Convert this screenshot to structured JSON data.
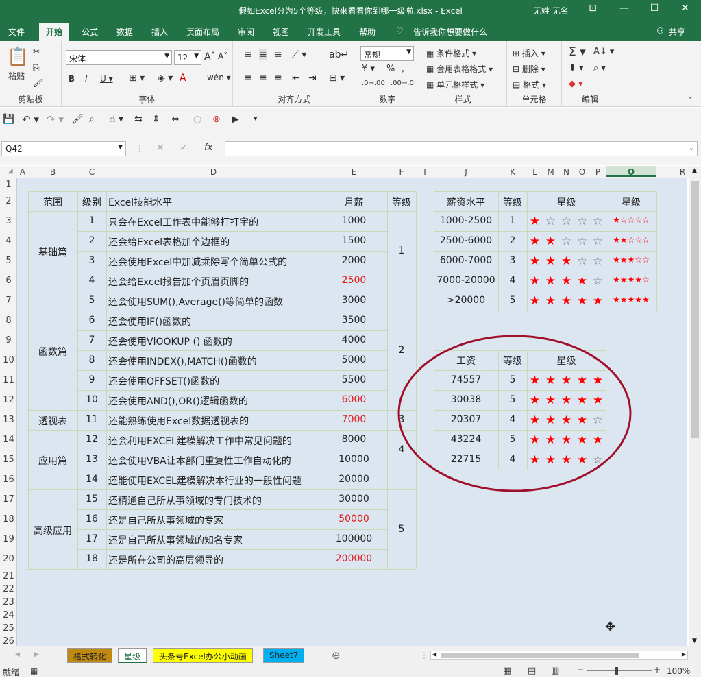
{
  "window": {
    "title": "假如Excel分为5个等级，快来看看你到哪一级啦.xlsx - Excel",
    "user": "无姓 无名"
  },
  "tabs": [
    "文件",
    "开始",
    "公式",
    "数据",
    "插入",
    "页面布局",
    "审阅",
    "视图",
    "开发工具",
    "帮助"
  ],
  "tell_me": "告诉我你想要做什么",
  "share": "共享",
  "ribbon": {
    "clipboard": "剪贴板",
    "paste": "粘贴",
    "font_group": "字体",
    "font_name": "宋体",
    "font_size": "12",
    "align": "对齐方式",
    "number": "数字",
    "number_format": "常规",
    "styles": "样式",
    "cond_format": "条件格式",
    "table_format": "套用表格格式",
    "cell_style": "单元格样式",
    "cells": "单元格",
    "insert": "插入",
    "delete": "删除",
    "format": "格式",
    "editing": "编辑"
  },
  "namebox": "Q42",
  "columns": [
    "A",
    "B",
    "C",
    "D",
    "E",
    "F",
    "I",
    "J",
    "K",
    "L",
    "M",
    "N",
    "O",
    "P",
    "Q",
    "R"
  ],
  "rows": [
    "1",
    "2",
    "3",
    "4",
    "5",
    "6",
    "7",
    "8",
    "9",
    "10",
    "11",
    "12",
    "13",
    "14",
    "15",
    "16",
    "17",
    "18",
    "19",
    "20",
    "21",
    "22",
    "23",
    "24",
    "25",
    "26"
  ],
  "main_table": {
    "headers": [
      "范围",
      "级别",
      "Excel技能水平",
      "月薪",
      "等级"
    ],
    "sections": [
      "基础篇",
      "函数篇",
      "透视表",
      "应用篇",
      "高级应用"
    ],
    "grades": [
      "1",
      "2",
      "3",
      "4",
      "5"
    ],
    "rows": [
      {
        "lv": "1",
        "skill": "只会在Excel工作表中能够打打字的",
        "pay": "1000",
        "red": false
      },
      {
        "lv": "2",
        "skill": "还会给Excel表格加个边框的",
        "pay": "1500",
        "red": false
      },
      {
        "lv": "3",
        "skill": "还会使用Excel中加减乘除写个简单公式的",
        "pay": "2000",
        "red": false
      },
      {
        "lv": "4",
        "skill": "还会给Excel报告加个页眉页脚的",
        "pay": "2500",
        "red": true
      },
      {
        "lv": "5",
        "skill": "还会使用SUM(),Average()等简单的函数",
        "pay": "3000",
        "red": false
      },
      {
        "lv": "6",
        "skill": "还会使用IF()函数的",
        "pay": "3500",
        "red": false
      },
      {
        "lv": "7",
        "skill": "还会使用VlOOKUP () 函数的",
        "pay": "4000",
        "red": false
      },
      {
        "lv": "8",
        "skill": "还会使用INDEX(),MATCH()函数的",
        "pay": "5000",
        "red": false
      },
      {
        "lv": "9",
        "skill": "还会使用OFFSET()函数的",
        "pay": "5500",
        "red": false
      },
      {
        "lv": "10",
        "skill": "还会使用AND(),OR()逻辑函数的",
        "pay": "6000",
        "red": true
      },
      {
        "lv": "11",
        "skill": "还能熟练使用Excel数据透视表的",
        "pay": "7000",
        "red": true
      },
      {
        "lv": "12",
        "skill": "还会利用EXCEL建模解决工作中常见问题的",
        "pay": "8000",
        "red": false
      },
      {
        "lv": "13",
        "skill": "还会使用VBA让本部门重复性工作自动化的",
        "pay": "10000",
        "red": false
      },
      {
        "lv": "14",
        "skill": "还能使用EXCEL建模解决本行业的一般性问题",
        "pay": "20000",
        "red": false
      },
      {
        "lv": "15",
        "skill": "还精通自己所从事领域的专门技术的",
        "pay": "30000",
        "red": false
      },
      {
        "lv": "16",
        "skill": "还是自己所从事领域的专家",
        "pay": "50000",
        "red": true
      },
      {
        "lv": "17",
        "skill": "还是自己所从事领域的知名专家",
        "pay": "100000",
        "red": false
      },
      {
        "lv": "18",
        "skill": "还是所在公司的高层领导的",
        "pay": "200000",
        "red": true
      }
    ]
  },
  "star_table": {
    "headers": [
      "薪资水平",
      "等级",
      "星级",
      "星级"
    ],
    "rows": [
      {
        "range": "1000-2500",
        "grade": "1",
        "text": "★☆☆☆☆",
        "stars": 1
      },
      {
        "range": "2500-6000",
        "grade": "2",
        "text": "★★☆☆☆",
        "stars": 2
      },
      {
        "range": "6000-7000",
        "grade": "3",
        "text": "★★★☆☆",
        "stars": 3
      },
      {
        "range": "7000-20000",
        "grade": "4",
        "text": "★★★★☆",
        "stars": 4
      },
      {
        "range": ">20000",
        "grade": "5",
        "text": "★★★★★",
        "stars": 5
      }
    ]
  },
  "salary_table": {
    "headers": [
      "工资",
      "等级",
      "星级"
    ],
    "rows": [
      {
        "pay": "74557",
        "grade": "5",
        "stars": 5
      },
      {
        "pay": "30038",
        "grade": "5",
        "stars": 5
      },
      {
        "pay": "20307",
        "grade": "4",
        "stars": 4
      },
      {
        "pay": "43224",
        "grade": "5",
        "stars": 5
      },
      {
        "pay": "22715",
        "grade": "4",
        "stars": 4
      }
    ]
  },
  "sheet_tabs": [
    "格式转化",
    "星级",
    "头条号Excel办公小动画",
    "Sheet7"
  ],
  "status": {
    "ready": "就绪",
    "zoom": "100%"
  },
  "colors": {
    "ribbon_green": "#217346",
    "star_red": "#ff0000",
    "oval": "#a0102a"
  }
}
